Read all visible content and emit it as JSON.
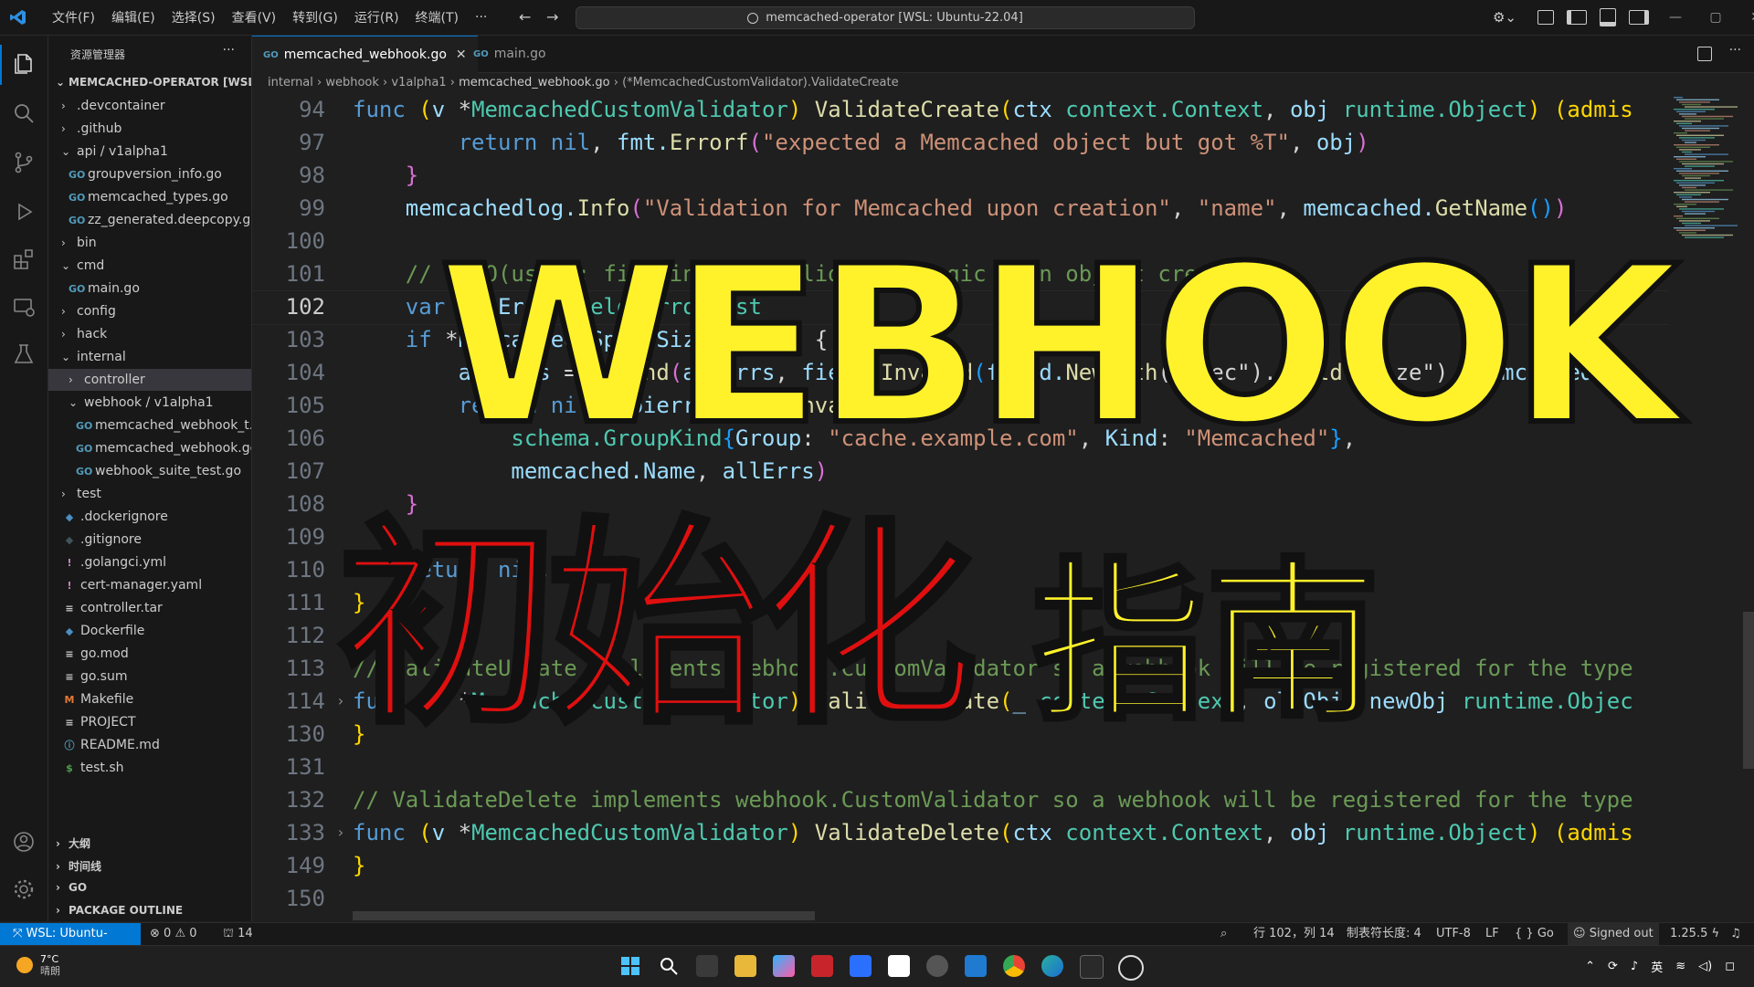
{
  "window": {
    "menus": [
      "文件(F)",
      "编辑(E)",
      "选择(S)",
      "查看(V)",
      "转到(G)",
      "运行(R)",
      "终端(T)",
      "···"
    ],
    "search_text": "memcached-operator [WSL: Ubuntu-22.04]"
  },
  "sidebar": {
    "title": "资源管理器",
    "more": "···",
    "root": "MEMCACHED-OPERATOR [WSL: ...",
    "items": [
      {
        "label": ".devcontainer",
        "depth": 1,
        "kind": "folder",
        "state": "collapsed"
      },
      {
        "label": ".github",
        "depth": 1,
        "kind": "folder",
        "state": "collapsed"
      },
      {
        "label": "api / v1alpha1",
        "depth": 1,
        "kind": "folder",
        "state": "expanded"
      },
      {
        "label": "groupversion_info.go",
        "depth": 2,
        "kind": "go"
      },
      {
        "label": "memcached_types.go",
        "depth": 2,
        "kind": "go"
      },
      {
        "label": "zz_generated.deepcopy.go",
        "depth": 2,
        "kind": "go"
      },
      {
        "label": "bin",
        "depth": 1,
        "kind": "folder",
        "state": "collapsed"
      },
      {
        "label": "cmd",
        "depth": 1,
        "kind": "folder",
        "state": "expanded"
      },
      {
        "label": "main.go",
        "depth": 2,
        "kind": "go"
      },
      {
        "label": "config",
        "depth": 1,
        "kind": "folder",
        "state": "collapsed"
      },
      {
        "label": "hack",
        "depth": 1,
        "kind": "folder",
        "state": "collapsed"
      },
      {
        "label": "internal",
        "depth": 1,
        "kind": "folder",
        "state": "expanded"
      },
      {
        "label": "controller",
        "depth": 2,
        "kind": "folder",
        "state": "collapsed",
        "selected": true
      },
      {
        "label": "webhook / v1alpha1",
        "depth": 2,
        "kind": "folder",
        "state": "expanded"
      },
      {
        "label": "memcached_webhook_t...",
        "depth": 3,
        "kind": "go"
      },
      {
        "label": "memcached_webhook.go",
        "depth": 3,
        "kind": "go"
      },
      {
        "label": "webhook_suite_test.go",
        "depth": 3,
        "kind": "go"
      },
      {
        "label": "test",
        "depth": 1,
        "kind": "folder",
        "state": "collapsed"
      },
      {
        "label": ".dockerignore",
        "depth": 1,
        "kind": "docker"
      },
      {
        "label": ".gitignore",
        "depth": 1,
        "kind": "git"
      },
      {
        "label": ".golangci.yml",
        "depth": 1,
        "kind": "yaml"
      },
      {
        "label": "cert-manager.yaml",
        "depth": 1,
        "kind": "yaml"
      },
      {
        "label": "controller.tar",
        "depth": 1,
        "kind": "text"
      },
      {
        "label": "Dockerfile",
        "depth": 1,
        "kind": "docker"
      },
      {
        "label": "go.mod",
        "depth": 1,
        "kind": "text"
      },
      {
        "label": "go.sum",
        "depth": 1,
        "kind": "text"
      },
      {
        "label": "Makefile",
        "depth": 1,
        "kind": "make"
      },
      {
        "label": "PROJECT",
        "depth": 1,
        "kind": "text"
      },
      {
        "label": "README.md",
        "depth": 1,
        "kind": "info"
      },
      {
        "label": "test.sh",
        "depth": 1,
        "kind": "shell"
      }
    ],
    "bottom_sections": [
      "大纲",
      "时间线",
      "GO",
      "PACKAGE OUTLINE"
    ]
  },
  "tabs": [
    {
      "label": "memcached_webhook.go",
      "active": true,
      "close": "✕"
    },
    {
      "label": "main.go",
      "active": false
    }
  ],
  "breadcrumb": [
    "internal",
    "webhook",
    "v1alpha1",
    "memcached_webhook.go",
    "(*MemcachedCustomValidator).ValidateCreate"
  ],
  "editor": {
    "current_line": "102",
    "lines": [
      {
        "n": "94",
        "fold": "",
        "segs": [
          [
            "kw",
            "func "
          ],
          [
            "br1",
            "("
          ],
          [
            "id",
            "v "
          ],
          [
            "pl",
            "*"
          ],
          [
            "ty",
            "MemcachedCustomValidator"
          ],
          [
            "br1",
            ") "
          ],
          [
            "fn",
            "ValidateCreate"
          ],
          [
            "br1",
            "("
          ],
          [
            "id",
            "ctx "
          ],
          [
            "ty",
            "context.Context"
          ],
          [
            "pl",
            ", "
          ],
          [
            "id",
            "obj "
          ],
          [
            "ty",
            "runtime.Object"
          ],
          [
            "br1",
            ") "
          ],
          [
            "br1",
            "(admis"
          ]
        ]
      },
      {
        "n": "97",
        "fold": "",
        "segs": [
          [
            "pl",
            "        "
          ],
          [
            "kw",
            "return "
          ],
          [
            "kw",
            "nil"
          ],
          [
            "pl",
            ", "
          ],
          [
            "id",
            "fmt."
          ],
          [
            "fn",
            "Errorf"
          ],
          [
            "br2",
            "("
          ],
          [
            "str",
            "\"expected a Memcached object but got %T\""
          ],
          [
            "pl",
            ", "
          ],
          [
            "id",
            "obj"
          ],
          [
            "br2",
            ")"
          ]
        ]
      },
      {
        "n": "98",
        "fold": "",
        "segs": [
          [
            "pl",
            "    "
          ],
          [
            "br2",
            "}"
          ]
        ]
      },
      {
        "n": "99",
        "fold": "",
        "segs": [
          [
            "pl",
            "    "
          ],
          [
            "id",
            "memcachedlog."
          ],
          [
            "fn",
            "Info"
          ],
          [
            "br2",
            "("
          ],
          [
            "str",
            "\"Validation for Memcached upon creation\""
          ],
          [
            "pl",
            ", "
          ],
          [
            "str",
            "\"name\""
          ],
          [
            "pl",
            ", "
          ],
          [
            "id",
            "memcached."
          ],
          [
            "fn",
            "GetName"
          ],
          [
            "br3",
            "()"
          ],
          [
            "br2",
            ")"
          ]
        ]
      },
      {
        "n": "100",
        "fold": "",
        "segs": [
          [
            "pl",
            ""
          ]
        ]
      },
      {
        "n": "101",
        "fold": "",
        "segs": [
          [
            "pl",
            "    "
          ],
          [
            "cm",
            "// TODO(user): fill in your validation logic upon object creation"
          ]
        ]
      },
      {
        "n": "102",
        "fold": "",
        "segs": [
          [
            "pl",
            "    "
          ],
          [
            "kw",
            "var "
          ],
          [
            "id",
            "allErrs "
          ],
          [
            "ty",
            "field.ErrorList"
          ]
        ]
      },
      {
        "n": "103",
        "fold": "",
        "segs": [
          [
            "pl",
            "    "
          ],
          [
            "kw",
            "if "
          ],
          [
            "pl",
            "*"
          ],
          [
            "id",
            "memcached.Spec.Size"
          ],
          [
            "pl",
            "&1 == 1 {"
          ]
        ]
      },
      {
        "n": "104",
        "fold": "",
        "segs": [
          [
            "pl",
            "        "
          ],
          [
            "id",
            "allErrs "
          ],
          [
            "pl",
            "= "
          ],
          [
            "fn",
            "append"
          ],
          [
            "br2",
            "("
          ],
          [
            "id",
            "allErrs"
          ],
          [
            "pl",
            ", "
          ],
          [
            "id",
            "field."
          ],
          [
            "fn",
            "Invalid"
          ],
          [
            "br3",
            "("
          ],
          [
            "id",
            "field."
          ],
          [
            "fn",
            "NewPath"
          ],
          [
            "pl",
            "(\"spec\")."
          ],
          [
            "fn",
            "Child"
          ],
          [
            "pl",
            "(\"size\"), "
          ],
          [
            "id",
            "memcached.Sp"
          ]
        ]
      },
      {
        "n": "105",
        "fold": "",
        "segs": [
          [
            "pl",
            "        "
          ],
          [
            "kw",
            "return "
          ],
          [
            "kw",
            "nil"
          ],
          [
            "pl",
            ", "
          ],
          [
            "id",
            "apierrors."
          ],
          [
            "fn",
            "NewInvalid"
          ],
          [
            "br2",
            "("
          ]
        ]
      },
      {
        "n": "106",
        "fold": "",
        "segs": [
          [
            "pl",
            "            "
          ],
          [
            "ty",
            "schema.GroupKind"
          ],
          [
            "br3",
            "{"
          ],
          [
            "id",
            "Group"
          ],
          [
            "pl",
            ": "
          ],
          [
            "str",
            "\"cache.example.com\""
          ],
          [
            "pl",
            ", "
          ],
          [
            "id",
            "Kind"
          ],
          [
            "pl",
            ": "
          ],
          [
            "str",
            "\"Memcached\""
          ],
          [
            "br3",
            "}"
          ],
          [
            "pl",
            ","
          ]
        ]
      },
      {
        "n": "107",
        "fold": "",
        "segs": [
          [
            "pl",
            "            "
          ],
          [
            "id",
            "memcached.Name"
          ],
          [
            "pl",
            ", "
          ],
          [
            "id",
            "allErrs"
          ],
          [
            "br2",
            ")"
          ]
        ]
      },
      {
        "n": "108",
        "fold": "",
        "segs": [
          [
            "pl",
            "    "
          ],
          [
            "br2",
            "}"
          ]
        ]
      },
      {
        "n": "109",
        "fold": "",
        "segs": [
          [
            "pl",
            ""
          ]
        ]
      },
      {
        "n": "110",
        "fold": "",
        "segs": [
          [
            "pl",
            "    "
          ],
          [
            "kw",
            "return "
          ],
          [
            "kw",
            "nil"
          ],
          [
            "pl",
            ", "
          ],
          [
            "kw",
            "nil"
          ]
        ]
      },
      {
        "n": "111",
        "fold": "",
        "segs": [
          [
            "br1",
            "}"
          ]
        ]
      },
      {
        "n": "112",
        "fold": "",
        "segs": [
          [
            "pl",
            ""
          ]
        ]
      },
      {
        "n": "113",
        "fold": "",
        "segs": [
          [
            "cm",
            "// ValidateUpdate implements webhook.CustomValidator so a webhook will be registered for the type"
          ]
        ]
      },
      {
        "n": "114",
        "fold": "›",
        "segs": [
          [
            "kw",
            "func "
          ],
          [
            "br1",
            "("
          ],
          [
            "id",
            "v "
          ],
          [
            "pl",
            "*"
          ],
          [
            "ty",
            "MemcachedCustomValidator"
          ],
          [
            "br1",
            ") "
          ],
          [
            "fn",
            "ValidateUpdate"
          ],
          [
            "br1",
            "("
          ],
          [
            "id",
            "_ "
          ],
          [
            "ty",
            "context.Context"
          ],
          [
            "pl",
            ", "
          ],
          [
            "id",
            "oldObj"
          ],
          [
            "pl",
            ", "
          ],
          [
            "id",
            "newObj "
          ],
          [
            "ty",
            "runtime.Objec"
          ]
        ]
      },
      {
        "n": "130",
        "fold": "",
        "segs": [
          [
            "br1",
            "}"
          ]
        ]
      },
      {
        "n": "131",
        "fold": "",
        "segs": [
          [
            "pl",
            ""
          ]
        ]
      },
      {
        "n": "132",
        "fold": "",
        "segs": [
          [
            "cm",
            "// ValidateDelete implements webhook.CustomValidator so a webhook will be registered for the type"
          ]
        ]
      },
      {
        "n": "133",
        "fold": "›",
        "segs": [
          [
            "kw",
            "func "
          ],
          [
            "br1",
            "("
          ],
          [
            "id",
            "v "
          ],
          [
            "pl",
            "*"
          ],
          [
            "ty",
            "MemcachedCustomValidator"
          ],
          [
            "br1",
            ") "
          ],
          [
            "fn",
            "ValidateDelete"
          ],
          [
            "br1",
            "("
          ],
          [
            "id",
            "ctx "
          ],
          [
            "ty",
            "context.Context"
          ],
          [
            "pl",
            ", "
          ],
          [
            "id",
            "obj "
          ],
          [
            "ty",
            "runtime.Object"
          ],
          [
            "br1",
            ") "
          ],
          [
            "br1",
            "(admis"
          ]
        ]
      },
      {
        "n": "149",
        "fold": "",
        "segs": [
          [
            "br1",
            "}"
          ]
        ]
      },
      {
        "n": "150",
        "fold": "",
        "segs": [
          [
            "pl",
            ""
          ]
        ]
      }
    ]
  },
  "overlay": {
    "title": "WEBHOOK",
    "subtitle_red": "初始化",
    "subtitle_yellow": "指南"
  },
  "status": {
    "remote": "WSL: Ubuntu-22.04",
    "errors": "0",
    "warnings": "0",
    "ports": "14",
    "position": "行 102，列 14",
    "tab_size": "制表符长度: 4",
    "encoding": "UTF-8",
    "eol": "LF",
    "language": "Go",
    "account": "Signed out",
    "version": "1.25.5"
  },
  "taskbar": {
    "temp": "7°C",
    "weather": "晴朗",
    "ime": "英"
  },
  "colors": {
    "accent": "#0078d4",
    "overlay_yellow": "#fff22a",
    "overlay_red": "#e00f0f"
  }
}
